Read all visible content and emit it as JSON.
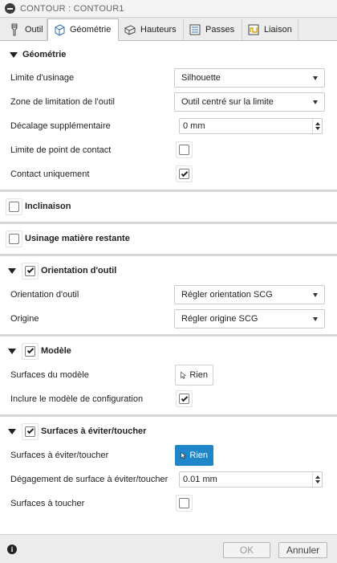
{
  "window": {
    "title": "CONTOUR : CONTOUR1"
  },
  "tabs": [
    {
      "label": "Outil",
      "icon": "tool-icon"
    },
    {
      "label": "Géométrie",
      "icon": "geometry-cube-icon"
    },
    {
      "label": "Hauteurs",
      "icon": "heights-icon"
    },
    {
      "label": "Passes",
      "icon": "passes-icon"
    },
    {
      "label": "Liaison",
      "icon": "linking-icon"
    }
  ],
  "geometry": {
    "title": "Géométrie",
    "limit_label": "Limite d'usinage",
    "limit_value": "Silhouette",
    "zone_label": "Zone de limitation de l'outil",
    "zone_value": "Outil centré sur la limite",
    "offset_label": "Décalage supplémentaire",
    "offset_value": "0 mm",
    "contact_point_label": "Limite de point de contact",
    "contact_point_checked": false,
    "contact_only_label": "Contact uniquement",
    "contact_only_checked": true
  },
  "tilt": {
    "title": "Inclinaison",
    "checked": false
  },
  "rest": {
    "title": "Usinage matière restante",
    "checked": false
  },
  "orientation": {
    "title": "Orientation d'outil",
    "checked": true,
    "orientation_label": "Orientation d'outil",
    "orientation_value": "Régler orientation SCG",
    "origin_label": "Origine",
    "origin_value": "Régler origine SCG"
  },
  "model": {
    "title": "Modèle",
    "checked": true,
    "surfaces_label": "Surfaces du modèle",
    "surfaces_value": "Rien",
    "include_label": "Inclure le modèle de configuration",
    "include_checked": true
  },
  "avoid": {
    "title": "Surfaces à éviter/toucher",
    "checked": true,
    "surfaces_label": "Surfaces à éviter/toucher",
    "surfaces_value": "Rien",
    "clearance_label": "Dégagement de surface à éviter/toucher",
    "clearance_value": "0.01 mm",
    "touch_label": "Surfaces à toucher",
    "touch_checked": false
  },
  "footer": {
    "ok_label": "OK",
    "cancel_label": "Annuler"
  },
  "colors": {
    "accent": "#1f86c8"
  }
}
